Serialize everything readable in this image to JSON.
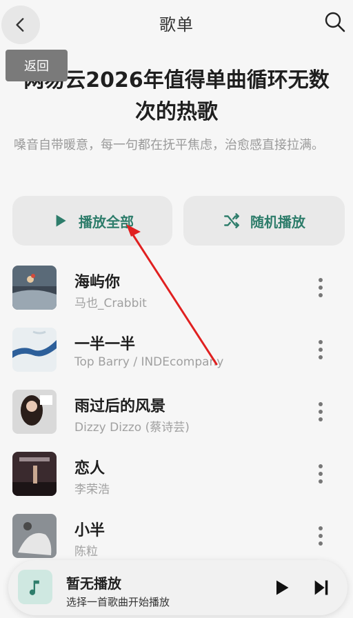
{
  "header": {
    "title": "歌单",
    "back_tooltip": "返回"
  },
  "playlist": {
    "title": "网易云2026年值得单曲循环无数次的热歌",
    "description": "嗓音自带暖意，每一句都在抚平焦虑，治愈感直接拉满。"
  },
  "actions": {
    "play_all": "播放全部",
    "shuffle": "随机播放"
  },
  "songs": [
    {
      "title": "海屿你",
      "artist": "马也_Crabbit"
    },
    {
      "title": "一半一半",
      "artist": "Top Barry / INDEcompany"
    },
    {
      "title": "雨过后的风景",
      "artist": "Dizzy Dizzo (蔡诗芸)"
    },
    {
      "title": "恋人",
      "artist": "李荣浩"
    },
    {
      "title": "小半",
      "artist": "陈粒"
    }
  ],
  "mini_player": {
    "title": "暂无播放",
    "subtitle": "选择一首歌曲开始播放"
  },
  "colors": {
    "accent": "#2e7d6b",
    "annotation": "#e02020"
  }
}
